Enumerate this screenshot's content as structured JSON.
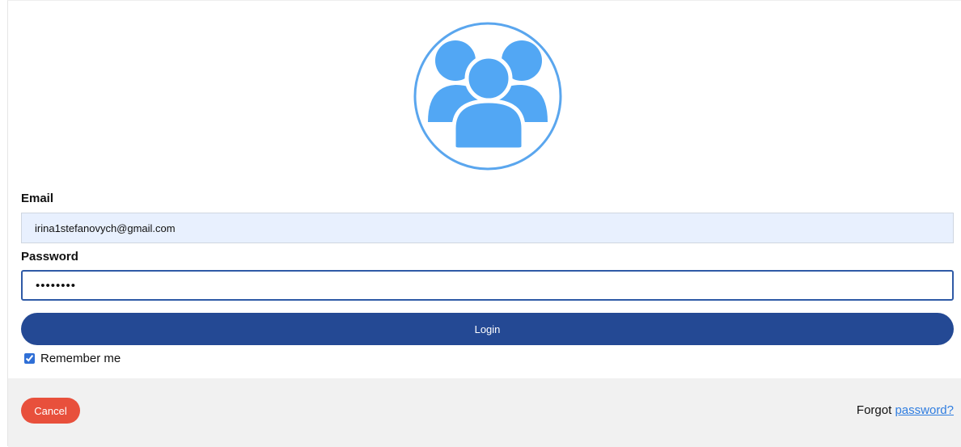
{
  "avatar": {
    "icon": "users-group-icon",
    "color": "#52a7f4"
  },
  "form": {
    "email_label": "Email",
    "email_value": "irina1stefanovych@gmail.com",
    "password_label": "Password",
    "password_value": "••••••••",
    "login_label": "Login",
    "remember_label": "Remember me",
    "remember_checked": true
  },
  "footer": {
    "cancel_label": "Cancel",
    "forgot_prefix": "Forgot",
    "forgot_link": "password?"
  },
  "colors": {
    "login_bg": "#244994",
    "cancel_bg": "#e8503c",
    "link": "#2f7de0",
    "email_bg": "#e8f0fe"
  }
}
